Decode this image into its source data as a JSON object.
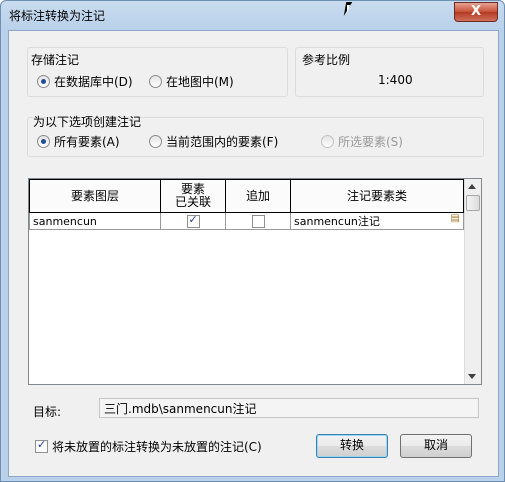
{
  "window": {
    "title": "将标注转换为注记",
    "close_label": "X"
  },
  "storage": {
    "heading": "存储注记",
    "options": [
      {
        "label": "在数据库中(D)",
        "selected": true
      },
      {
        "label": "在地图中(M)",
        "selected": false
      }
    ]
  },
  "scale": {
    "heading": "参考比例",
    "value": "1:400"
  },
  "create_for": {
    "heading": "为以下选项创建注记",
    "options": [
      {
        "label": "所有要素(A)",
        "selected": true,
        "enabled": true
      },
      {
        "label": "当前范围内的要素(F)",
        "selected": false,
        "enabled": true
      },
      {
        "label": "所选要素(S)",
        "selected": false,
        "enabled": false
      }
    ]
  },
  "table": {
    "columns": [
      "要素图层",
      "要素已关联",
      "追加",
      "注记要素类"
    ],
    "column_line1": "要素",
    "column_line2": "已关联",
    "rows": [
      {
        "layer": "sanmencun",
        "linked": true,
        "append": false,
        "class": "sanmencun注记"
      }
    ]
  },
  "target": {
    "label": "目标:",
    "value": "三门.mdb\\sanmencun注记"
  },
  "unplaced": {
    "label": "将未放置的标注转换为未放置的注记(C)",
    "checked": true
  },
  "buttons": {
    "convert": "转换",
    "cancel": "取消"
  },
  "colors": {
    "title_bar": "#b9d1ea",
    "close_button": "#c75037",
    "dialog_bg": "#f0f0f0"
  }
}
